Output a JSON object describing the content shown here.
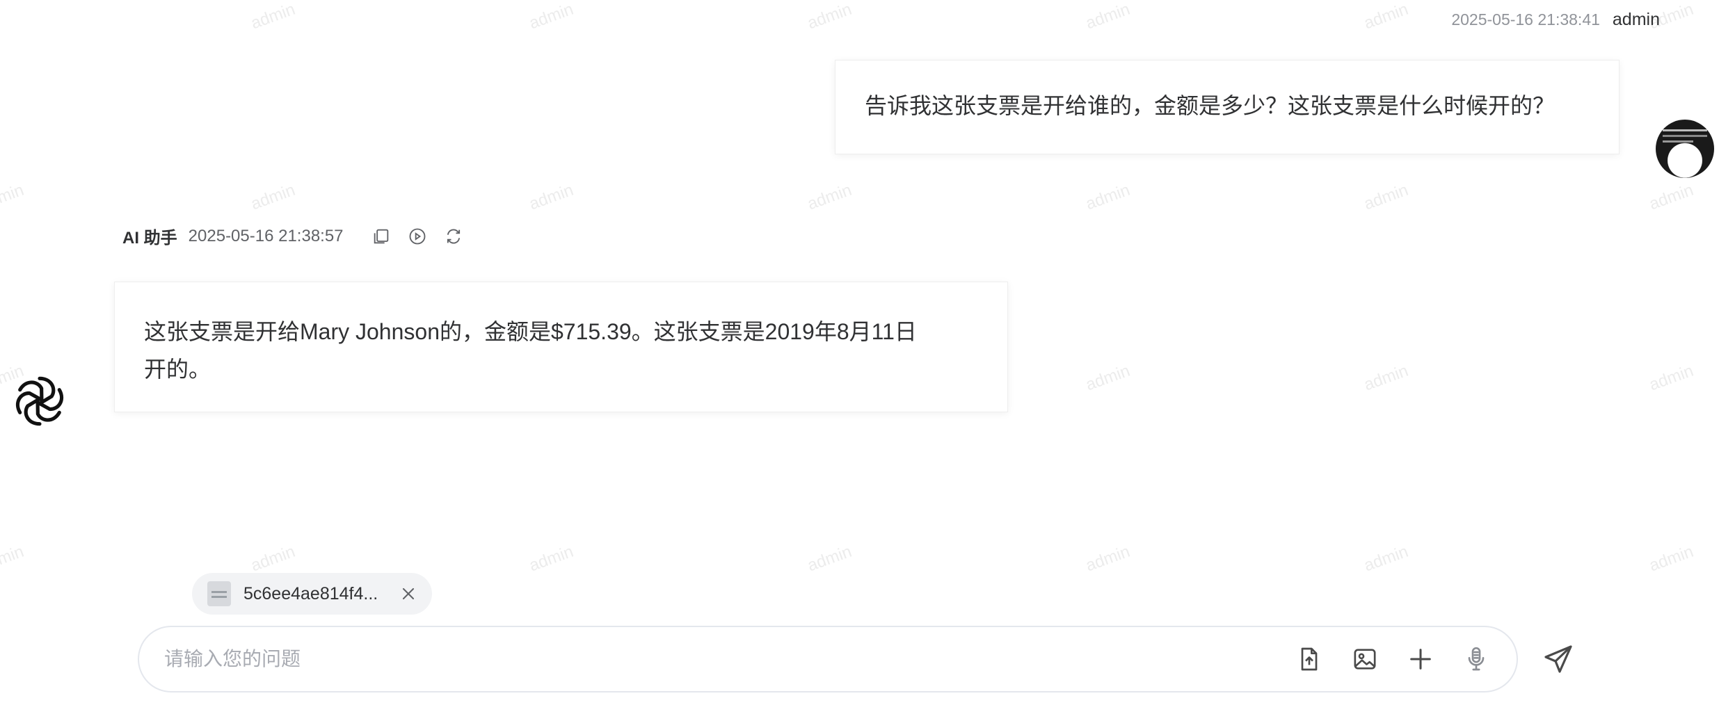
{
  "watermark": "admin",
  "user_message": {
    "timestamp": "2025-05-16 21:38:41",
    "username": "admin",
    "text": "告诉我这张支票是开给谁的，金额是多少？这张支票是什么时候开的？"
  },
  "ai_message": {
    "name": "AI 助手",
    "timestamp": "2025-05-16 21:38:57",
    "actions": [
      "copy-icon",
      "play-icon",
      "refresh-icon"
    ],
    "text_line1": "这张支票是开给Mary Johnson的，金额是$715.39。这张支票是2019年8月11日",
    "text_line2": "开的。"
  },
  "attachment": {
    "filename": "5c6ee4ae814f4..."
  },
  "input": {
    "placeholder": "请输入您的问题",
    "value": "",
    "tools": [
      "upload-file-icon",
      "image-icon",
      "plus-icon",
      "microphone-icon"
    ]
  },
  "send_icon": "send-icon"
}
